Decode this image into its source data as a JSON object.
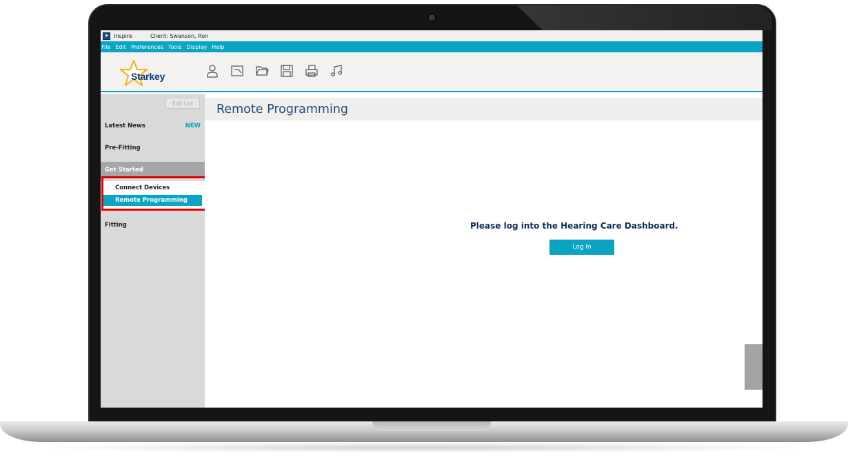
{
  "window": {
    "app_name": "Inspire",
    "client": "Client: Swanson, Ron"
  },
  "menu": [
    "File",
    "Edit",
    "Preferences",
    "Tools",
    "Display",
    "Help"
  ],
  "brand": {
    "logo_text": "Starkey"
  },
  "toolbar_icons": [
    "person-icon",
    "chart-icon",
    "folder-icon",
    "save-icon",
    "print-icon",
    "music-icon"
  ],
  "sidebar": {
    "edit_list": "Edit List",
    "latest_news": "Latest News",
    "new_badge": "NEW",
    "pre_fitting": "Pre-Fitting",
    "get_started": "Get Started",
    "connect_devices": "Connect Devices",
    "remote_programming": "Remote Programming",
    "fitting": "Fitting"
  },
  "main": {
    "page_title": "Remote Programming",
    "login_prompt": "Please log into the Hearing Care Dashboard.",
    "login_button": "Log In"
  },
  "colors": {
    "accent": "#0ba5c4",
    "title_blue": "#1f4e79",
    "highlight": "#e60000"
  }
}
